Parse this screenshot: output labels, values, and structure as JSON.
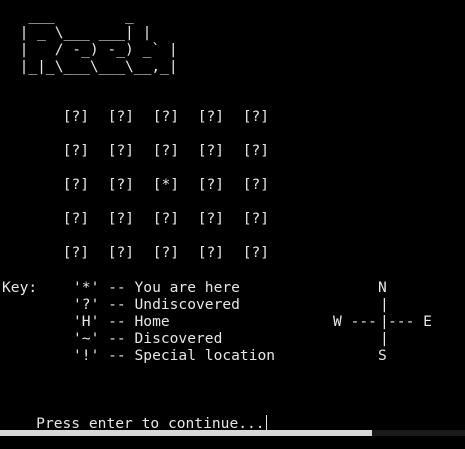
{
  "banner": [
    "   ___        _",
    "  | _ \\___ ___| |",
    "  |   / -_) -_) _` |",
    "  |_|_\\___\\___\\__,_|"
  ],
  "map": {
    "rows": [
      [
        "[?]",
        "[?]",
        "[?]",
        "[?]",
        "[?]"
      ],
      [
        "[?]",
        "[?]",
        "[?]",
        "[?]",
        "[?]"
      ],
      [
        "[?]",
        "[?]",
        "[*]",
        "[?]",
        "[?]"
      ],
      [
        "[?]",
        "[?]",
        "[?]",
        "[?]",
        "[?]"
      ],
      [
        "[?]",
        "[?]",
        "[?]",
        "[?]",
        "[?]"
      ]
    ]
  },
  "key": {
    "label": "Key:",
    "entries": [
      "'*' -- You are here",
      "'?' -- Undiscovered",
      "'H' -- Home",
      "'~' -- Discovered",
      "'!' -- Special location"
    ]
  },
  "compass": {
    "north": "N",
    "vertical": "|",
    "west": "W ---",
    "center": "|",
    "east": "--- E",
    "south": "S"
  },
  "prompt": "Press enter to continue..."
}
